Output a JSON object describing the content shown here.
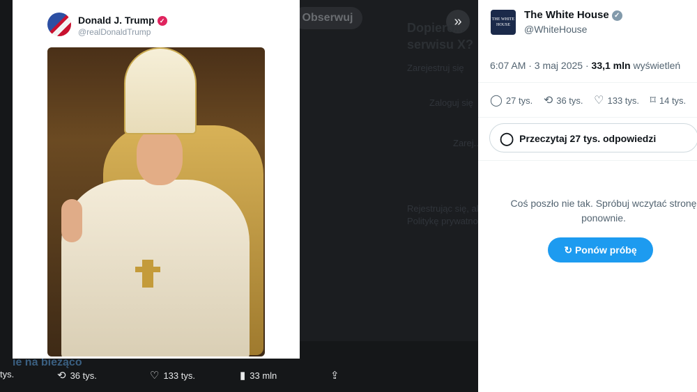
{
  "tweet": {
    "author_name": "Donald J. Trump",
    "author_handle": "@realDonaldTrump",
    "actions": {
      "replies": "tys.",
      "retweets": "36 tys.",
      "likes": "133 tys.",
      "views": "33 mln"
    }
  },
  "background": {
    "follow_label": "Obserwuj",
    "expand_icon": "»",
    "faint_title": "Dopiero... serwisu X?",
    "faint_lines": [
      "Zarejestruj się",
      "Zaloguj się",
      "Zarej...",
      "Rejestrując się, akceptujesz",
      "Politykę prywatności"
    ],
    "faint_bottom": "ie na bieżąco"
  },
  "panel": {
    "author_name": "The White House",
    "author_handle": "@WhiteHouse",
    "logo_text": "THE WHITE HOUSE",
    "time": "6:07 AM · 3 maj 2025 · ",
    "views_value": "33,1 mln",
    "views_label": " wyświetleń",
    "stats": {
      "replies": "27 tys.",
      "retweets": "36 tys.",
      "likes": "133 tys.",
      "bookmarks": "14 tys."
    },
    "read_replies_label": "Przeczytaj 27 tys. odpowiedzi",
    "error_message": "Coś poszło nie tak. Spróbuj wczytać stronę ponownie.",
    "retry_label": "Ponów próbę"
  },
  "colors": {
    "accent": "#1d9bf0",
    "verified_gray": "#829aab",
    "verified_pink": "#e0245e"
  }
}
